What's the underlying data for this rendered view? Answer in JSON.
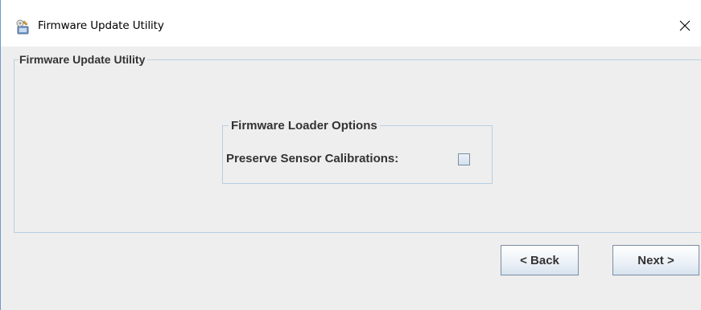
{
  "window": {
    "title": "Firmware Update Utility",
    "icon": "app-icon",
    "close_icon": "close-icon"
  },
  "main_group": {
    "legend": "Firmware Update Utility"
  },
  "options_group": {
    "legend": "Firmware Loader Options",
    "preserve_label": "Preserve Sensor Calibrations:",
    "preserve_checked": false
  },
  "nav": {
    "back_label": "< Back",
    "next_label": "Next >"
  },
  "colors": {
    "border_accent": "#b8cfe5",
    "window_edge": "#6e9ac9"
  }
}
